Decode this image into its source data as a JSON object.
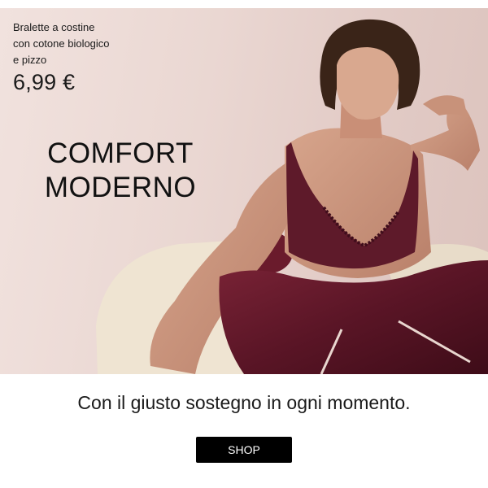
{
  "hero": {
    "product_lines": [
      "Bralette a costine",
      "con cotone biologico",
      "e pizzo"
    ],
    "price": "6,99 €",
    "headline_lines": [
      "COMFORT",
      "MODERNO"
    ]
  },
  "tagline": "Con il giusto sostegno in ogni momento.",
  "cta": {
    "label": "SHOP"
  },
  "colors": {
    "hero_background": "#ead7d2",
    "garment": "#5e1a2a",
    "button": "#000000",
    "button_text": "#ffffff"
  }
}
